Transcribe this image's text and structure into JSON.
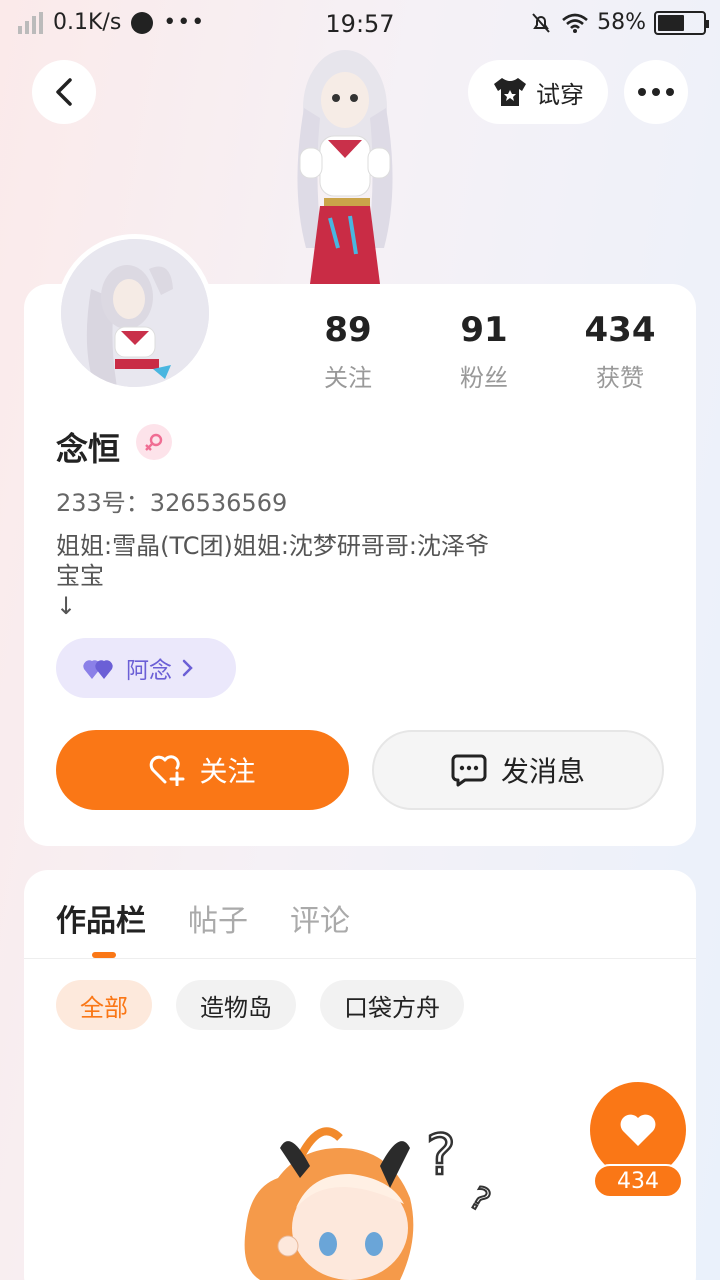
{
  "status_bar": {
    "network_speed": "0.1K/s",
    "time": "19:57",
    "battery": "58%",
    "battery_level": 0.58
  },
  "header": {
    "try_on_label": "试穿"
  },
  "profile": {
    "stats": [
      {
        "value": "89",
        "label": "关注"
      },
      {
        "value": "91",
        "label": "粉丝"
      },
      {
        "value": "434",
        "label": "获赞"
      }
    ],
    "username": "念恒",
    "gender": "female",
    "uid": "233号：326536569",
    "bio": [
      "姐姐:雪晶(TC团)姐姐:沈梦研哥哥:沈泽爷",
      "宝宝",
      "↓"
    ],
    "club_tag": "阿念",
    "follow_label": "关注",
    "message_label": "发消息"
  },
  "works": {
    "tabs": [
      "作品栏",
      "帖子",
      "评论"
    ],
    "filters": [
      "全部",
      "造物岛",
      "口袋方舟"
    ],
    "like_count": "434"
  },
  "colors": {
    "accent": "#fa7716",
    "club_purple": "#6b5fd6"
  }
}
